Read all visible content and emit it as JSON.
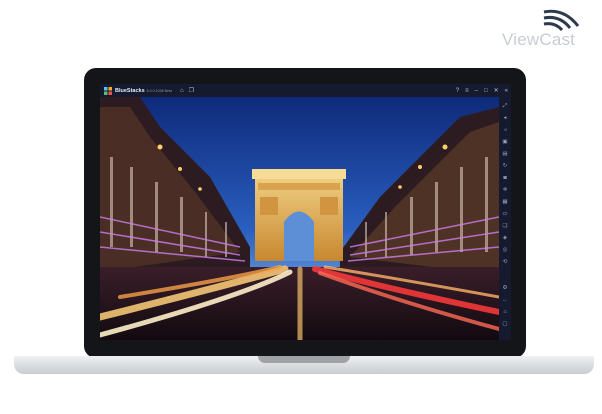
{
  "watermark": {
    "text": "ViewCast"
  },
  "app": {
    "name": "BlueStacks",
    "version": "5.0.0.1038 Beta"
  },
  "titlebar_left_icons": [
    "home-icon",
    "multi-instance-icon"
  ],
  "titlebar_right_icons": [
    "help-icon",
    "menu-icon",
    "minimize-icon",
    "maximize-icon",
    "close-icon",
    "collapse-sidebar-icon"
  ],
  "sidebar_icons": [
    "fullscreen-icon",
    "volume-up-icon",
    "volume-down-icon",
    "screen-record-icon",
    "keyboard-icon",
    "rotate-icon",
    "camera-icon",
    "shake-icon",
    "apk-install-icon",
    "folder-icon",
    "copy-icon",
    "eco-mode-icon",
    "macro-icon",
    "sync-icon",
    "settings-icon",
    "back-icon",
    "home-nav-icon",
    "recent-apps-icon"
  ],
  "scene": {
    "subject": "Arc de Triomphe at night with light trails"
  }
}
